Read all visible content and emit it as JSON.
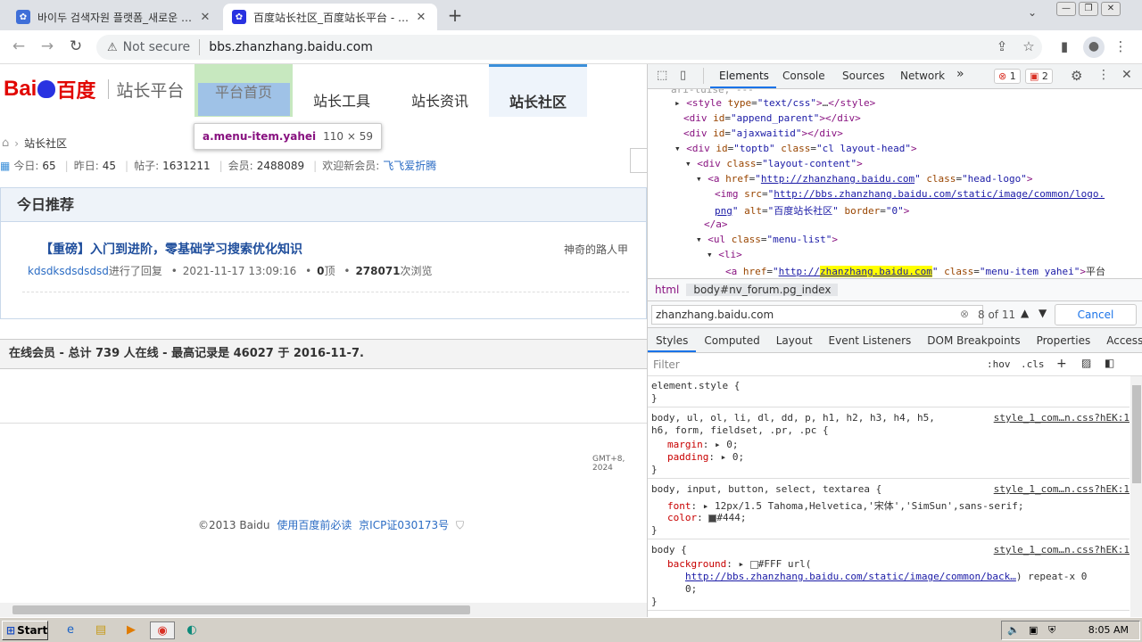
{
  "browser": {
    "tabs": [
      {
        "title": "바이두 검색자원 플랫폼_새로운 검색",
        "favicon": "paw-icon"
      },
      {
        "title": "百度站长社区_百度站长平台 - Powe",
        "favicon": "paw-icon"
      }
    ],
    "address": {
      "security": "Not secure",
      "url": "bbs.zhanzhang.baidu.com"
    }
  },
  "page": {
    "logo": {
      "bai": "Bai",
      "du": "百度",
      "subtitle": "站长平台"
    },
    "menu": [
      "平台首页",
      "站长工具",
      "站长资讯",
      "站长社区"
    ],
    "tooltip": {
      "selector": "a.menu-item.yahei",
      "size": "110 × 59"
    },
    "breadcrumb": "站长社区",
    "stats": {
      "today_label": "今日:",
      "today": "65",
      "yesterday_label": "昨日:",
      "yesterday": "45",
      "posts_label": "帖子:",
      "posts": "1631211",
      "members_label": "会员:",
      "members": "2488089",
      "welcome_label": "欢迎新会员:",
      "new_member": "飞飞爱折腾"
    },
    "recommend": {
      "heading": "今日推荐",
      "title": "【重磅】入门到进阶，零基础学习搜索优化知识",
      "author": "神奇的路人甲",
      "replier": "kdsdksdsdsdsd",
      "reply_text": "进行了回复",
      "datetime": "2021-11-17 13:09:16",
      "likes": "0",
      "likes_unit": "顶",
      "views": "278071",
      "views_unit": "次浏览"
    },
    "online": "在线会员 - 总计 739 人在线 - 最高记录是 46027 于 2016-11-7.",
    "gmt": "GMT+8, 2024",
    "footer": {
      "copy": "©2013 Baidu",
      "link1": "使用百度前必读",
      "link2": "京ICP证030173号"
    }
  },
  "devtools": {
    "tabs": [
      "Elements",
      "Console",
      "Sources",
      "Network"
    ],
    "errors": "1",
    "issues": "2",
    "breadcrumb": [
      "html",
      "body#nv_forum.pg_index"
    ],
    "find": {
      "query": "zhanzhang.baidu.com",
      "count": "8 of 11",
      "cancel": "Cancel"
    },
    "style_tabs": [
      "Styles",
      "Computed",
      "Layout",
      "Event Listeners",
      "DOM Breakpoints",
      "Properties",
      "Accessibility"
    ],
    "filter_placeholder": "Filter",
    "hov": ":hov",
    "cls": ".cls",
    "src": "style_1_com…n.css?hEK:1"
  },
  "taskbar": {
    "start": "Start",
    "time": "8:05 AM"
  },
  "colors": {
    "accent": "#1a73e8",
    "baidu_red": "#e10602",
    "link": "#2b6cc4"
  }
}
